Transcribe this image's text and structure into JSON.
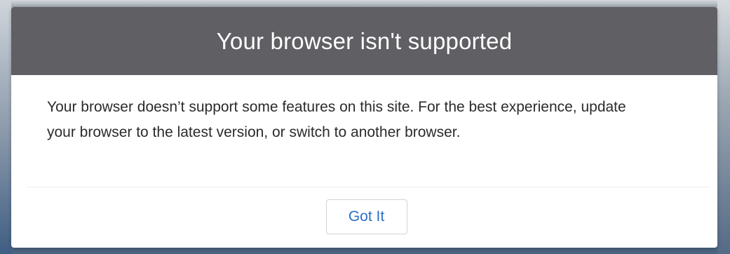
{
  "modal": {
    "title": "Your browser isn't supported",
    "message": "Your browser doesn’t support some features on this site. For the best experience, update your browser to the latest version, or switch to another browser.",
    "button_label": "Got It"
  },
  "colors": {
    "header_background": "#5f5f64",
    "button_text": "#2c6fc7",
    "message_text": "#2b2b2b"
  }
}
